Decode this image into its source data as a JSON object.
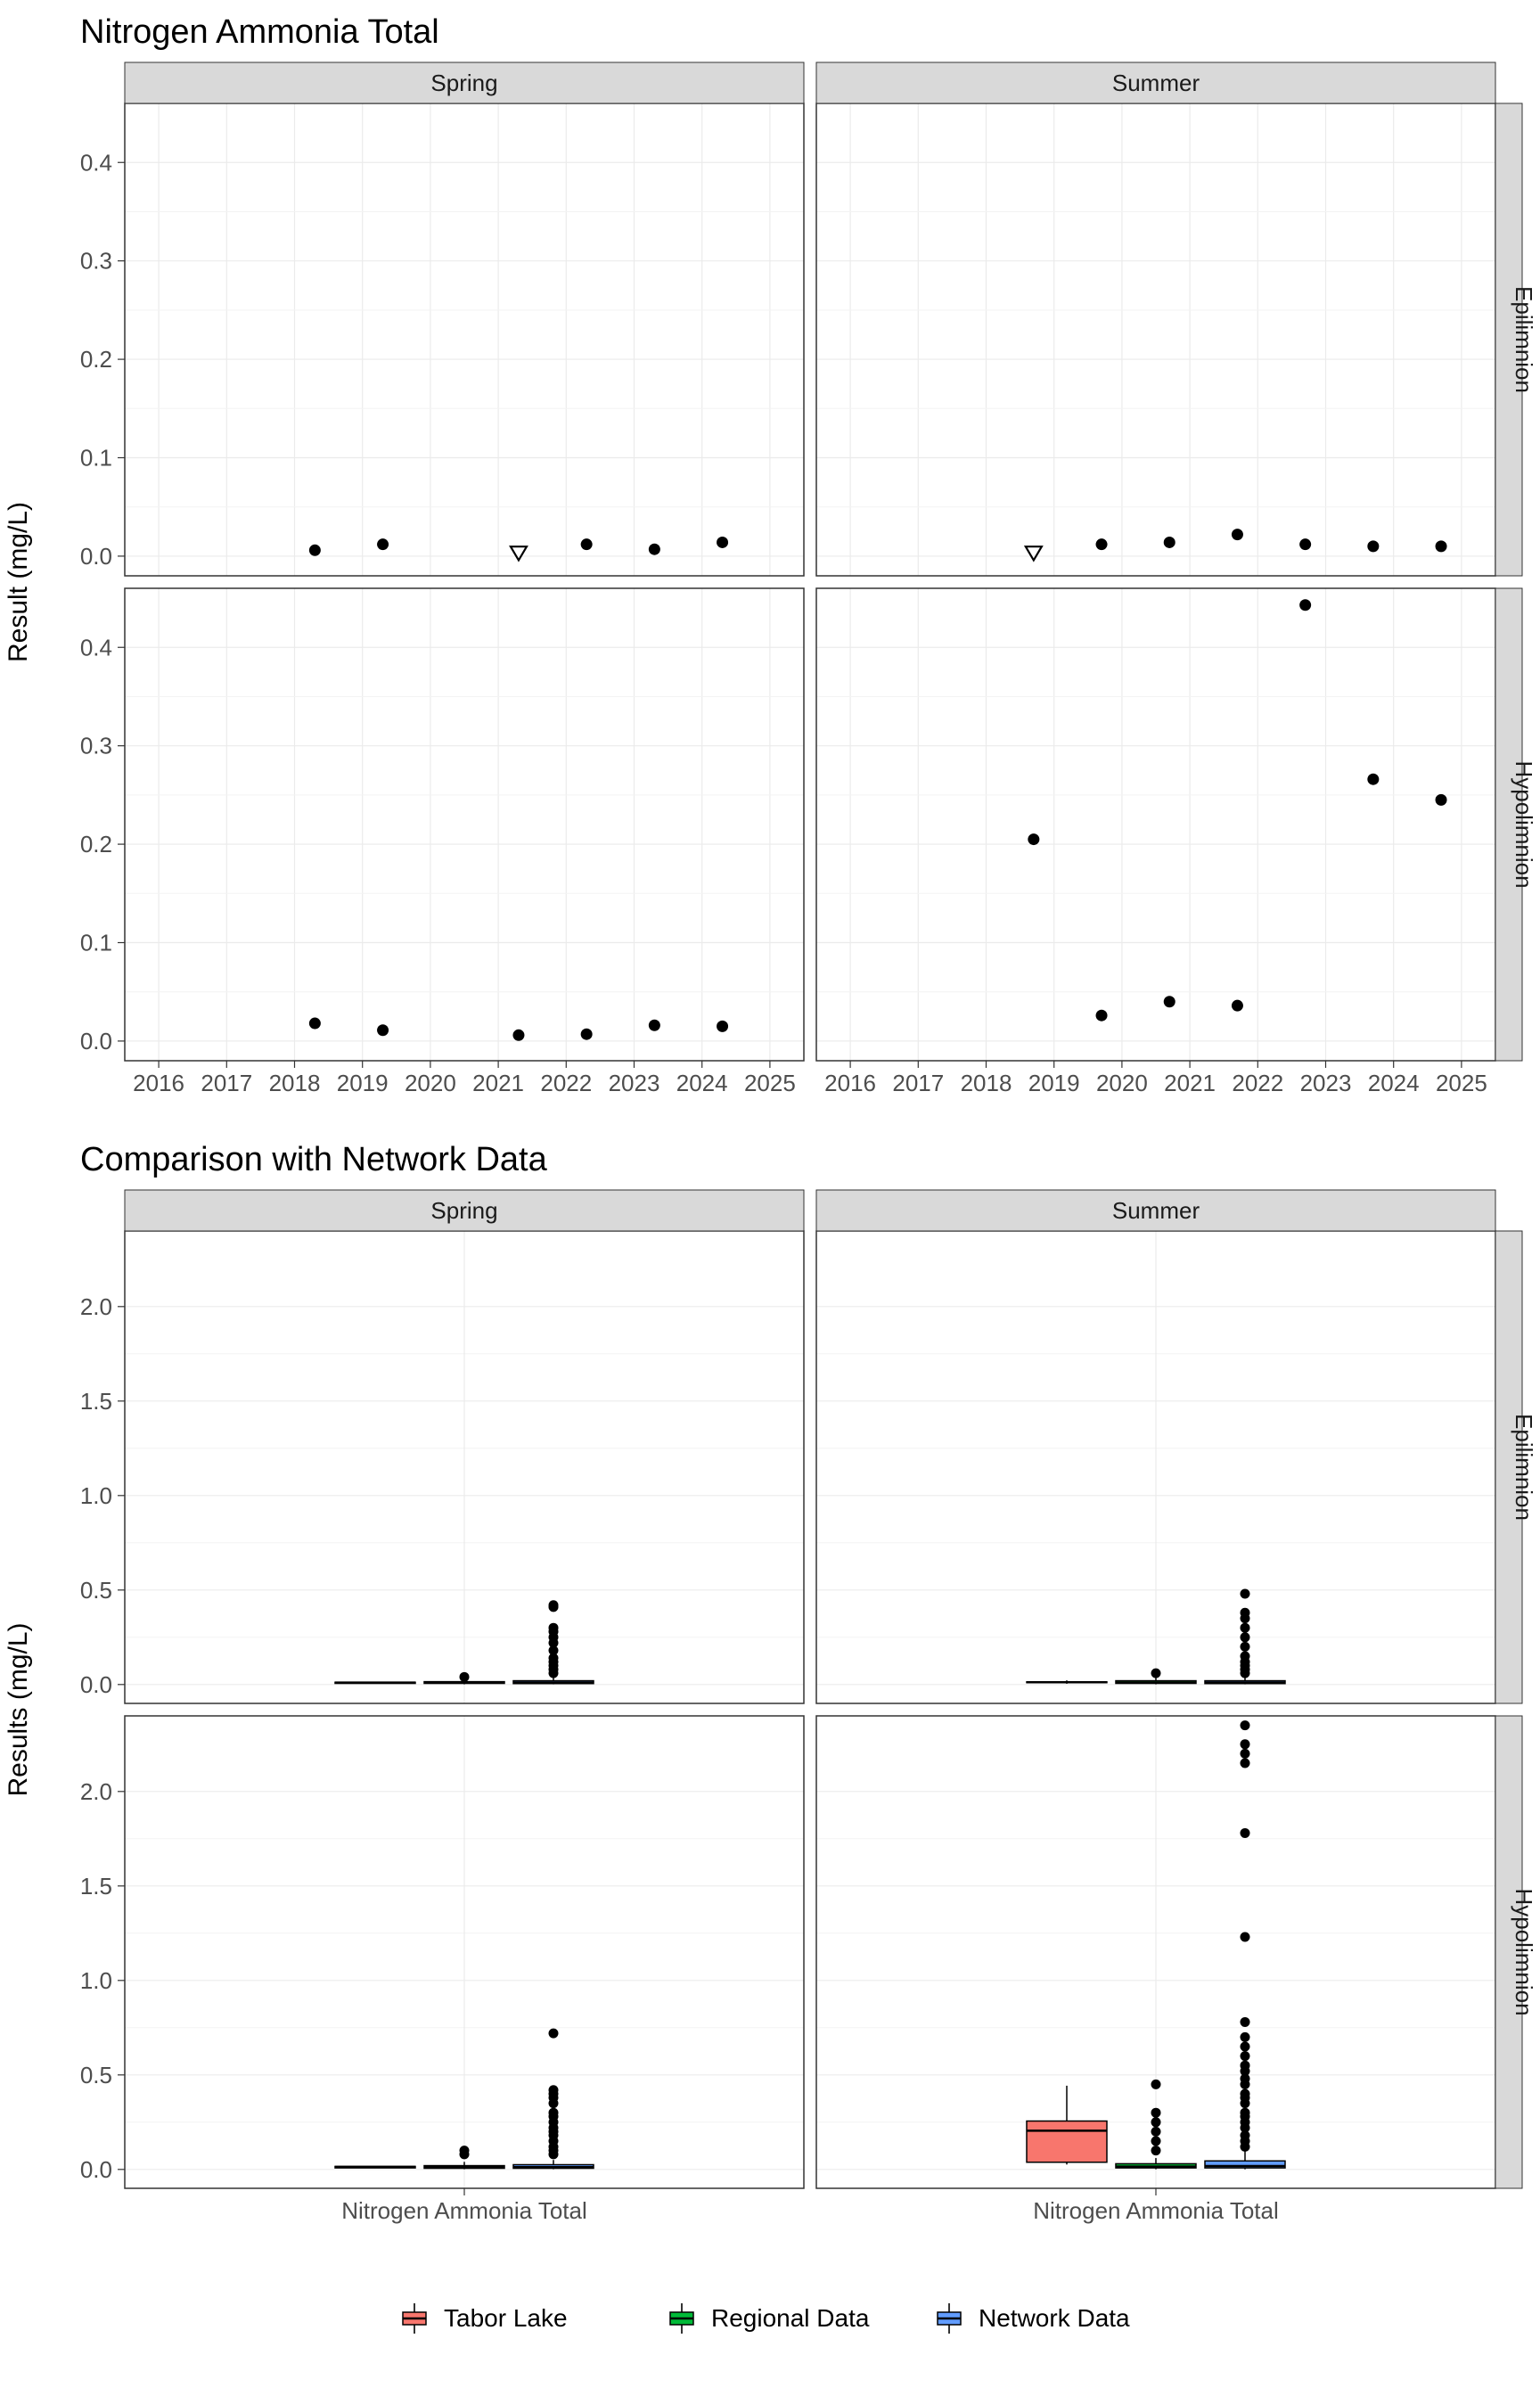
{
  "chart_data": [
    {
      "type": "scatter",
      "title": "Nitrogen Ammonia Total",
      "xlabel": "",
      "ylabel": "Result (mg/L)",
      "x_ticks": [
        2016,
        2017,
        2018,
        2019,
        2020,
        2021,
        2022,
        2023,
        2024,
        2025
      ],
      "y_ticks": [
        0.0,
        0.1,
        0.2,
        0.3,
        0.4
      ],
      "xlim": [
        2015.5,
        2025.5
      ],
      "ylim": [
        -0.02,
        0.46
      ],
      "facets": {
        "cols": [
          "Spring",
          "Summer"
        ],
        "rows": [
          "Epilimnion",
          "Hypolimnion"
        ]
      },
      "series": [
        {
          "facet_col": "Spring",
          "facet_row": "Epilimnion",
          "points": [
            {
              "x": 2018.3,
              "y": 0.006,
              "open": false
            },
            {
              "x": 2019.3,
              "y": 0.012,
              "open": false
            },
            {
              "x": 2021.3,
              "y": 0.004,
              "open": true
            },
            {
              "x": 2022.3,
              "y": 0.012,
              "open": false
            },
            {
              "x": 2023.3,
              "y": 0.007,
              "open": false
            },
            {
              "x": 2024.3,
              "y": 0.014,
              "open": false
            }
          ]
        },
        {
          "facet_col": "Spring",
          "facet_row": "Hypolimnion",
          "points": [
            {
              "x": 2018.3,
              "y": 0.018,
              "open": false
            },
            {
              "x": 2019.3,
              "y": 0.011,
              "open": false
            },
            {
              "x": 2021.3,
              "y": 0.006,
              "open": false
            },
            {
              "x": 2022.3,
              "y": 0.007,
              "open": false
            },
            {
              "x": 2023.3,
              "y": 0.016,
              "open": false
            },
            {
              "x": 2024.3,
              "y": 0.015,
              "open": false
            }
          ]
        },
        {
          "facet_col": "Summer",
          "facet_row": "Epilimnion",
          "points": [
            {
              "x": 2018.7,
              "y": 0.004,
              "open": true
            },
            {
              "x": 2019.7,
              "y": 0.012,
              "open": false
            },
            {
              "x": 2020.7,
              "y": 0.014,
              "open": false
            },
            {
              "x": 2021.7,
              "y": 0.022,
              "open": false
            },
            {
              "x": 2022.7,
              "y": 0.012,
              "open": false
            },
            {
              "x": 2023.7,
              "y": 0.01,
              "open": false
            },
            {
              "x": 2024.7,
              "y": 0.01,
              "open": false
            }
          ]
        },
        {
          "facet_col": "Summer",
          "facet_row": "Hypolimnion",
          "points": [
            {
              "x": 2018.7,
              "y": 0.205,
              "open": false
            },
            {
              "x": 2019.7,
              "y": 0.026,
              "open": false
            },
            {
              "x": 2020.7,
              "y": 0.04,
              "open": false
            },
            {
              "x": 2021.7,
              "y": 0.036,
              "open": false
            },
            {
              "x": 2022.7,
              "y": 0.443,
              "open": false
            },
            {
              "x": 2023.7,
              "y": 0.266,
              "open": false
            },
            {
              "x": 2024.7,
              "y": 0.245,
              "open": false
            }
          ]
        }
      ]
    },
    {
      "type": "boxplot",
      "title": "Comparison with Network Data",
      "xlabel": "",
      "ylabel": "Results (mg/L)",
      "x_categories": [
        "Nitrogen Ammonia Total"
      ],
      "y_ticks": [
        0.0,
        0.5,
        1.0,
        1.5,
        2.0
      ],
      "ylim": [
        -0.1,
        2.4
      ],
      "facets": {
        "cols": [
          "Spring",
          "Summer"
        ],
        "rows": [
          "Epilimnion",
          "Hypolimnion"
        ]
      },
      "legend": [
        "Tabor Lake",
        "Regional Data",
        "Network Data"
      ],
      "colors": {
        "Tabor Lake": "#F8766D",
        "Regional Data": "#00BA38",
        "Network Data": "#619CFF"
      },
      "series": [
        {
          "facet_col": "Spring",
          "facet_row": "Epilimnion",
          "boxes": [
            {
              "name": "Tabor Lake",
              "min": 0.004,
              "q1": 0.006,
              "median": 0.01,
              "q3": 0.012,
              "max": 0.014,
              "outliers": []
            },
            {
              "name": "Regional Data",
              "min": 0.001,
              "q1": 0.006,
              "median": 0.01,
              "q3": 0.015,
              "max": 0.025,
              "outliers": [
                0.04
              ]
            },
            {
              "name": "Network Data",
              "min": 0.001,
              "q1": 0.005,
              "median": 0.01,
              "q3": 0.02,
              "max": 0.04,
              "outliers": [
                0.06,
                0.08,
                0.1,
                0.12,
                0.14,
                0.18,
                0.22,
                0.25,
                0.28,
                0.3,
                0.41,
                0.42
              ]
            }
          ]
        },
        {
          "facet_col": "Spring",
          "facet_row": "Hypolimnion",
          "boxes": [
            {
              "name": "Tabor Lake",
              "min": 0.006,
              "q1": 0.008,
              "median": 0.013,
              "q3": 0.016,
              "max": 0.018,
              "outliers": []
            },
            {
              "name": "Regional Data",
              "min": 0.001,
              "q1": 0.006,
              "median": 0.012,
              "q3": 0.02,
              "max": 0.04,
              "outliers": [
                0.08,
                0.1
              ]
            },
            {
              "name": "Network Data",
              "min": 0.001,
              "q1": 0.006,
              "median": 0.012,
              "q3": 0.025,
              "max": 0.05,
              "outliers": [
                0.08,
                0.1,
                0.12,
                0.15,
                0.18,
                0.2,
                0.22,
                0.25,
                0.28,
                0.3,
                0.35,
                0.38,
                0.4,
                0.42,
                0.72
              ]
            }
          ]
        },
        {
          "facet_col": "Summer",
          "facet_row": "Epilimnion",
          "boxes": [
            {
              "name": "Tabor Lake",
              "min": 0.004,
              "q1": 0.01,
              "median": 0.012,
              "q3": 0.014,
              "max": 0.022,
              "outliers": []
            },
            {
              "name": "Regional Data",
              "min": 0.001,
              "q1": 0.006,
              "median": 0.01,
              "q3": 0.02,
              "max": 0.04,
              "outliers": [
                0.06
              ]
            },
            {
              "name": "Network Data",
              "min": 0.001,
              "q1": 0.005,
              "median": 0.01,
              "q3": 0.02,
              "max": 0.04,
              "outliers": [
                0.06,
                0.08,
                0.1,
                0.12,
                0.15,
                0.2,
                0.25,
                0.3,
                0.35,
                0.38,
                0.48
              ]
            }
          ]
        },
        {
          "facet_col": "Summer",
          "facet_row": "Hypolimnion",
          "boxes": [
            {
              "name": "Tabor Lake",
              "min": 0.026,
              "q1": 0.038,
              "median": 0.205,
              "q3": 0.256,
              "max": 0.443,
              "outliers": []
            },
            {
              "name": "Regional Data",
              "min": 0.001,
              "q1": 0.008,
              "median": 0.015,
              "q3": 0.03,
              "max": 0.06,
              "outliers": [
                0.1,
                0.15,
                0.2,
                0.25,
                0.3,
                0.45
              ]
            },
            {
              "name": "Network Data",
              "min": 0.001,
              "q1": 0.008,
              "median": 0.018,
              "q3": 0.045,
              "max": 0.1,
              "outliers": [
                0.12,
                0.15,
                0.18,
                0.22,
                0.25,
                0.28,
                0.3,
                0.35,
                0.38,
                0.4,
                0.45,
                0.48,
                0.52,
                0.55,
                0.6,
                0.65,
                0.7,
                0.78,
                1.23,
                1.78,
                2.15,
                2.2,
                2.25,
                2.35
              ]
            }
          ]
        }
      ]
    }
  ]
}
